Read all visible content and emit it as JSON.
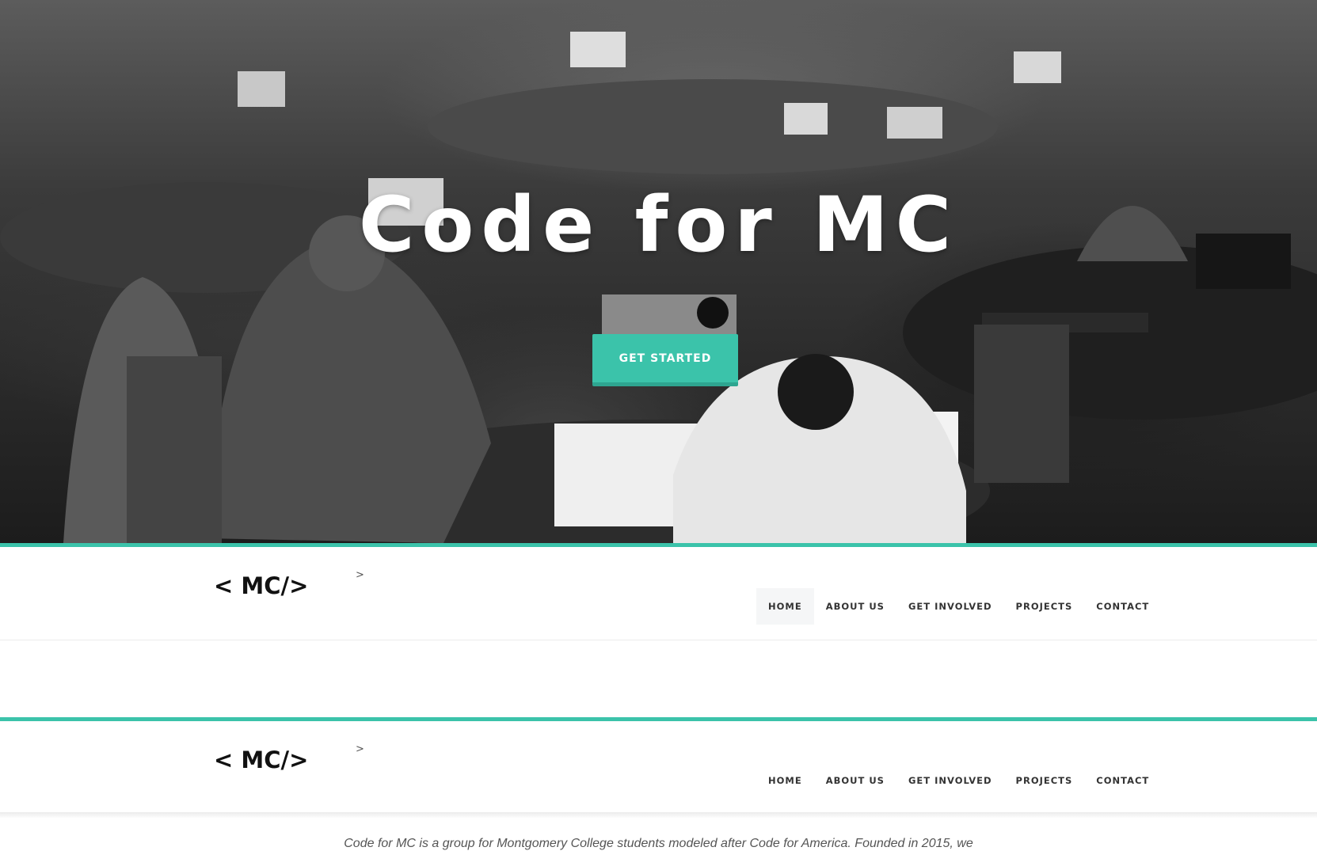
{
  "hero": {
    "title": "Code for MC",
    "cta_label": "GET STARTED",
    "background_description": "grayscale photo of students working on laptops at round tables"
  },
  "brand": {
    "logo": "< MC/>",
    "caret": ">"
  },
  "nav": {
    "items": [
      {
        "label": "HOME",
        "active": true
      },
      {
        "label": "ABOUT US",
        "active": false
      },
      {
        "label": "GET INVOLVED",
        "active": false
      },
      {
        "label": "PROJECTS",
        "active": false
      },
      {
        "label": "CONTACT",
        "active": false
      }
    ]
  },
  "sticky_nav": {
    "items": [
      {
        "label": "HOME"
      },
      {
        "label": "ABOUT US"
      },
      {
        "label": "GET INVOLVED"
      },
      {
        "label": "PROJECTS"
      },
      {
        "label": "CONTACT"
      }
    ]
  },
  "intro": {
    "text": "Code for MC is a group for Montgomery College students modeled after Code for America. Founded in 2015, we"
  },
  "colors": {
    "accent": "#3bc3aa",
    "nav_text": "#333333",
    "logo": "#111111"
  }
}
